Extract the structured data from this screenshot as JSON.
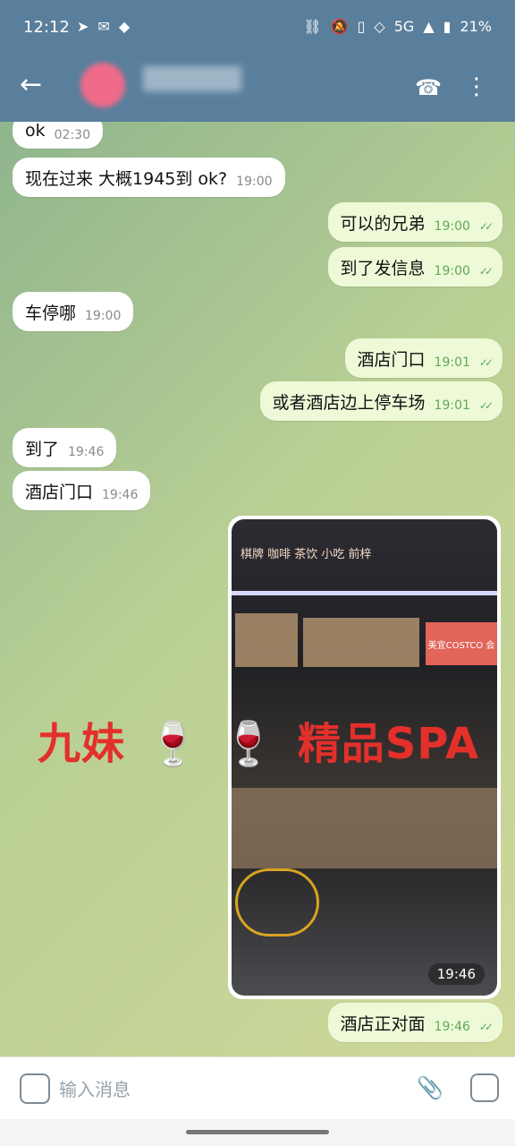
{
  "status": {
    "time": "12:12",
    "network": "5G",
    "battery": "21%"
  },
  "header": {
    "icons": [
      "back-arrow-icon",
      "phone-icon",
      "kebab-menu-icon"
    ]
  },
  "messages": [
    {
      "text": "ok",
      "time": "02:30",
      "dir": "in"
    },
    {
      "text": "现在过来 大概1945到 ok?",
      "time": "19:00",
      "dir": "in"
    },
    {
      "text": "可以的兄弟",
      "time": "19:00",
      "dir": "out"
    },
    {
      "text": "到了发信息",
      "time": "19:00",
      "dir": "out"
    },
    {
      "text": "车停哪",
      "time": "19:00",
      "dir": "in"
    },
    {
      "text": "酒店门口",
      "time": "19:01",
      "dir": "out"
    },
    {
      "text": "或者酒店边上停车场",
      "time": "19:01",
      "dir": "out"
    },
    {
      "text": "到了",
      "time": "19:46",
      "dir": "in"
    },
    {
      "text": "酒店门口",
      "time": "19:46",
      "dir": "in"
    },
    {
      "text": "酒店正对面",
      "time": "19:46",
      "dir": "out"
    }
  ],
  "photo": {
    "time": "19:46",
    "sign": "棋牌 咖啡 茶饮 小吃 前梓",
    "store": "美宜COSTCO 会"
  },
  "overlay": {
    "text1": "九妹",
    "emoji": "🍷",
    "text2": "精品SPA"
  },
  "composer": {
    "placeholder": "输入消息"
  }
}
